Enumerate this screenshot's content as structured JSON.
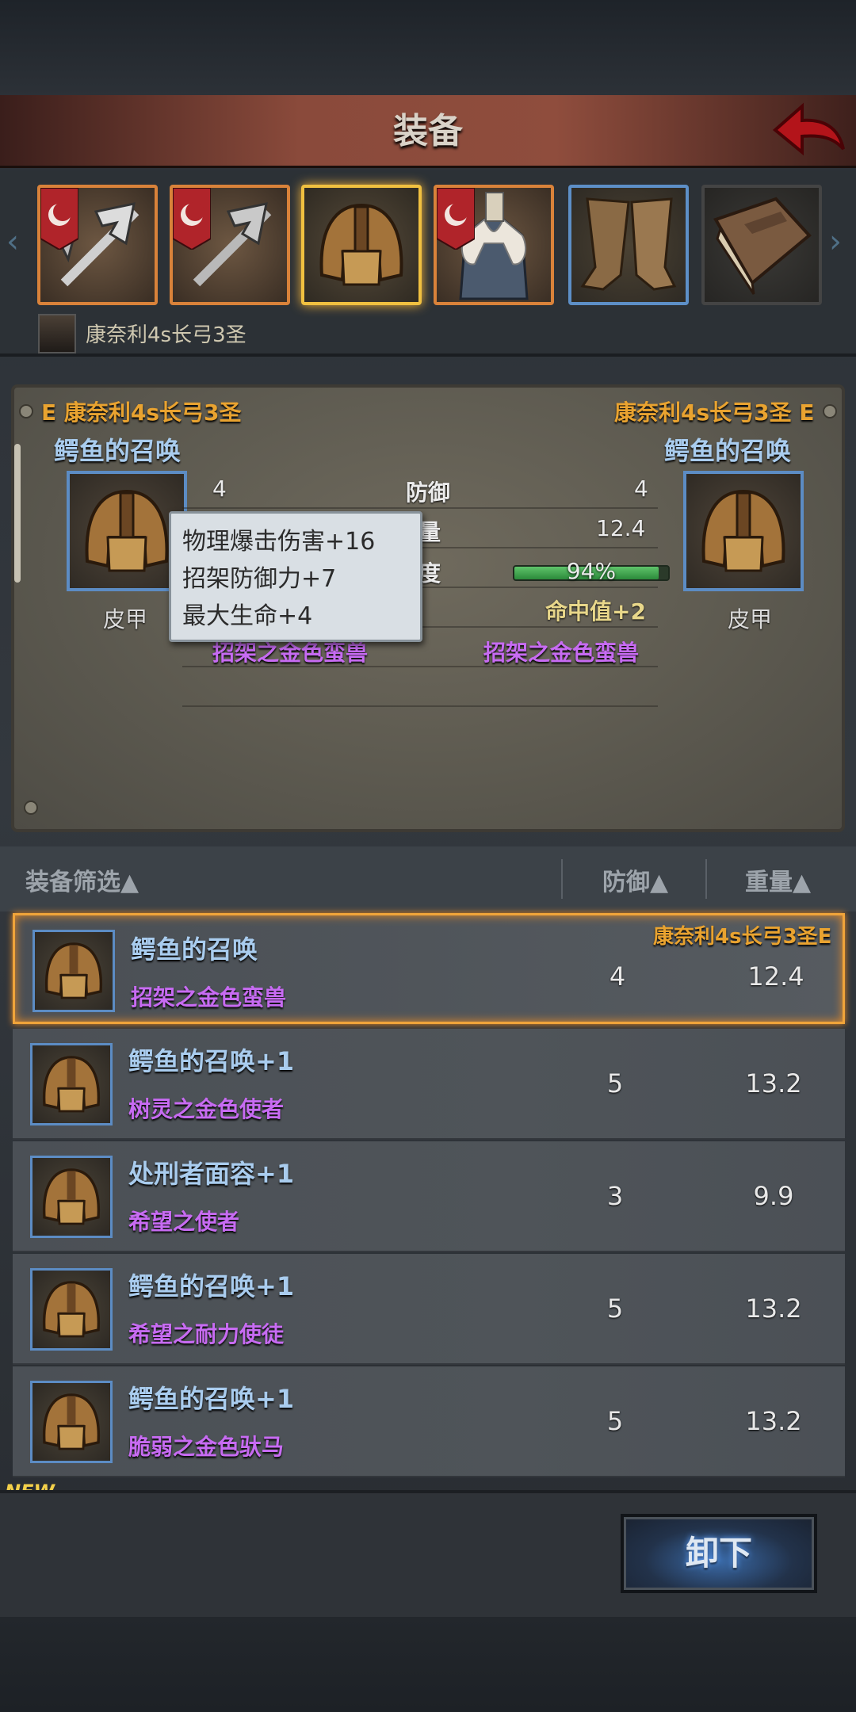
{
  "header": {
    "title": "装备"
  },
  "slots": [
    {
      "name": "weapon-slot-1",
      "icon": "halberd-icon"
    },
    {
      "name": "weapon-slot-2",
      "icon": "halberd-icon"
    },
    {
      "name": "helmet-slot",
      "icon": "helmet-icon"
    },
    {
      "name": "armor-slot",
      "icon": "fur-coat-icon"
    },
    {
      "name": "boots-slot",
      "icon": "boots-icon"
    },
    {
      "name": "book-slot",
      "icon": "book-icon"
    }
  ],
  "character": {
    "name": "康奈利4s长弓3圣"
  },
  "compare": {
    "left": {
      "owner": "E 康奈利4s长弓3圣",
      "name": "鳄鱼的召唤",
      "type": "皮甲",
      "defense": "4",
      "suffix": "招架之金色蛮兽"
    },
    "right": {
      "owner": "康奈利4s长弓3圣 E",
      "name": "鳄鱼的召唤",
      "type": "皮甲",
      "defense": "4",
      "weight": "12.4",
      "durability": "94%",
      "durability_value": 0.94,
      "bonus": "命中值+2",
      "suffix": "招架之金色蛮兽"
    },
    "labels": {
      "defense": "防御",
      "weight": "重量",
      "durability": "耐久度"
    }
  },
  "tooltip": [
    "物理爆击伤害+16",
    "招架防御力+7",
    "最大生命+4"
  ],
  "list": {
    "headers": {
      "filter": "装备筛选▲",
      "defense": "防御▲",
      "weight": "重量▲"
    },
    "rows": [
      {
        "name": "鳄鱼的召唤",
        "sub": "招架之金色蛮兽",
        "defense": "4",
        "weight": "12.4",
        "owner": "康奈利4s长弓3圣E",
        "selected": true
      },
      {
        "name": "鳄鱼的召唤+1",
        "sub": "树灵之金色使者",
        "defense": "5",
        "weight": "13.2"
      },
      {
        "name": "处刑者面容+1",
        "sub": "希望之使者",
        "defense": "3",
        "weight": "9.9"
      },
      {
        "name": "鳄鱼的召唤+1",
        "sub": "希望之耐力使徒",
        "defense": "5",
        "weight": "13.2"
      },
      {
        "name": "鳄鱼的召唤+1",
        "sub": "脆弱之金色驮马",
        "defense": "5",
        "weight": "13.2"
      }
    ]
  },
  "new_tag": "NEW",
  "bottom": {
    "unequip_label": "卸下"
  }
}
